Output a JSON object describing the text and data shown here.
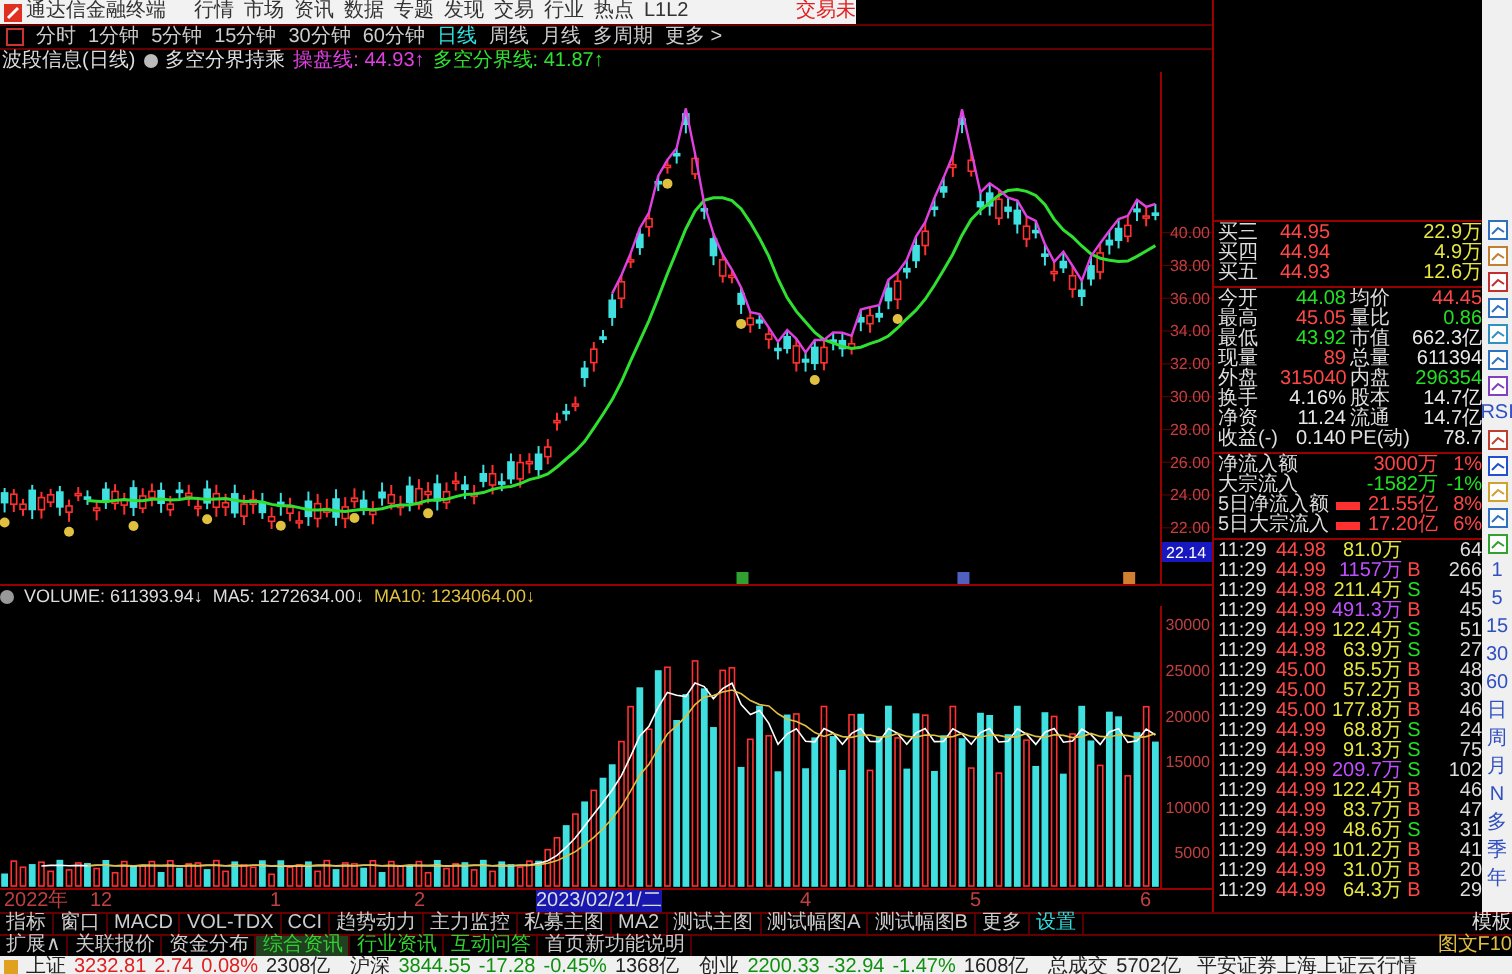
{
  "title_bar": {
    "app": "通达信金融终端",
    "menu": [
      "行情",
      "市场",
      "资讯",
      "数据",
      "专题",
      "发现",
      "交易",
      "行业",
      "热点",
      "L1L2"
    ],
    "login": "交易未"
  },
  "periods": [
    {
      "label": "分时",
      "selected": false
    },
    {
      "label": "1分钟",
      "selected": false
    },
    {
      "label": "5分钟",
      "selected": false
    },
    {
      "label": "15分钟",
      "selected": false
    },
    {
      "label": "30分钟",
      "selected": false
    },
    {
      "label": "60分钟",
      "selected": false
    },
    {
      "label": "日线",
      "selected": true
    },
    {
      "label": "周线",
      "selected": false
    },
    {
      "label": "月线",
      "selected": false
    },
    {
      "label": "多周期",
      "selected": false
    },
    {
      "label": "更多 >",
      "selected": false
    }
  ],
  "indicator": {
    "name": "波段信息(日线)",
    "formula": "多空分界持乘",
    "values": [
      {
        "label": "操盘线: 44.93↑",
        "kind": "trade"
      },
      {
        "label": "多空分界线: 41.87↑",
        "kind": "boundary"
      }
    ]
  },
  "price_axis": {
    "ticks": [
      "40.00",
      "38.00",
      "36.00",
      "34.00",
      "32.00",
      "30.00",
      "28.00",
      "26.00",
      "24.00",
      "22.00"
    ],
    "current": "22.14"
  },
  "volume": {
    "header": [
      {
        "text": "VOLUME: 611393.94↓",
        "kind": "vol"
      },
      {
        "text": "MA5: 1272634.00↓",
        "kind": "ma5"
      },
      {
        "text": "MA10: 1234064.00↓",
        "kind": "ma10"
      }
    ],
    "axis": [
      "30000",
      "25000",
      "20000",
      "15000",
      "10000",
      "5000"
    ]
  },
  "date_axis": [
    {
      "label": "2022年",
      "highlight": false
    },
    {
      "label": "12",
      "highlight": false
    },
    {
      "label": "1",
      "highlight": false
    },
    {
      "label": "2",
      "highlight": false
    },
    {
      "label": "2023/02/21/二",
      "highlight": true
    },
    {
      "label": "4",
      "highlight": false
    },
    {
      "label": "5",
      "highlight": false
    },
    {
      "label": "6",
      "highlight": false
    }
  ],
  "quote": {
    "book": [
      {
        "label": "买三",
        "price": "44.95",
        "volume": "22.9万"
      },
      {
        "label": "买四",
        "price": "44.94",
        "volume": "4.9万"
      },
      {
        "label": "买五",
        "price": "44.93",
        "volume": "12.6万"
      }
    ],
    "stats": [
      {
        "label": "今开",
        "value": "44.08",
        "color": "#22e022"
      },
      {
        "label": "均价",
        "value": "44.45",
        "color": "#ff4646"
      },
      {
        "label": "最高",
        "value": "45.05",
        "color": "#ff4646"
      },
      {
        "label": "量比",
        "value": "0.86",
        "color": "#22e022"
      },
      {
        "label": "最低",
        "value": "43.92",
        "color": "#22e022"
      },
      {
        "label": "市值",
        "value": "662.3亿",
        "color": "#e8e8e8"
      },
      {
        "label": "现量",
        "value": "89",
        "color": "#ff4646"
      },
      {
        "label": "总量",
        "value": "611394",
        "color": "#e8e8e8"
      },
      {
        "label": "外盘",
        "value": "315040",
        "color": "#ff4646"
      },
      {
        "label": "内盘",
        "value": "296354",
        "color": "#22e022"
      },
      {
        "label": "换手",
        "value": "4.16%",
        "color": "#e8e8e8"
      },
      {
        "label": "股本",
        "value": "14.7亿",
        "color": "#e8e8e8"
      },
      {
        "label": "净资",
        "value": "11.24",
        "color": "#e8e8e8"
      },
      {
        "label": "流通",
        "value": "14.7亿",
        "color": "#e8e8e8"
      },
      {
        "label": "收益(-)",
        "value": "0.140",
        "color": "#e8e8e8"
      },
      {
        "label": "PE(动)",
        "value": "78.7",
        "color": "#e8e8e8"
      }
    ],
    "flows": [
      {
        "label": "净流入额",
        "bar": false,
        "amount": "3000万",
        "pct": "1%",
        "color": "#ff4646"
      },
      {
        "label": "大宗流入",
        "bar": false,
        "amount": "-1582万",
        "pct": "-1%",
        "color": "#22e022"
      },
      {
        "label": "5日净流入额",
        "bar": true,
        "amount": "21.55亿",
        "pct": "8%",
        "color": "#ff4646"
      },
      {
        "label": "5日大宗流入",
        "bar": true,
        "amount": "17.20亿",
        "pct": "6%",
        "color": "#ff4646"
      }
    ]
  },
  "trades": [
    {
      "time": "11:29",
      "price": "44.98",
      "volume": "81.0万",
      "count": "64",
      "large": false
    },
    {
      "time": "11:29",
      "price": "44.99",
      "volume": "1157万",
      "side": "B",
      "count": "266",
      "large": true
    },
    {
      "time": "11:29",
      "price": "44.98",
      "volume": "211.4万",
      "side": "S",
      "count": "45",
      "large": false
    },
    {
      "time": "11:29",
      "price": "44.99",
      "volume": "491.3万",
      "side": "B",
      "count": "45",
      "large": true
    },
    {
      "time": "11:29",
      "price": "44.99",
      "volume": "122.4万",
      "side": "S",
      "count": "51",
      "large": false
    },
    {
      "time": "11:29",
      "price": "44.98",
      "volume": "63.9万",
      "side": "S",
      "count": "27",
      "large": false
    },
    {
      "time": "11:29",
      "price": "45.00",
      "volume": "85.5万",
      "side": "B",
      "count": "48",
      "large": false
    },
    {
      "time": "11:29",
      "price": "45.00",
      "volume": "57.2万",
      "side": "B",
      "count": "30",
      "large": false
    },
    {
      "time": "11:29",
      "price": "45.00",
      "volume": "177.8万",
      "side": "B",
      "count": "46",
      "large": false
    },
    {
      "time": "11:29",
      "price": "44.99",
      "volume": "68.8万",
      "side": "S",
      "count": "24",
      "large": false
    },
    {
      "time": "11:29",
      "price": "44.99",
      "volume": "91.3万",
      "side": "S",
      "count": "75",
      "large": false
    },
    {
      "time": "11:29",
      "price": "44.99",
      "volume": "209.7万",
      "side": "S",
      "count": "102",
      "large": true
    },
    {
      "time": "11:29",
      "price": "44.99",
      "volume": "122.4万",
      "side": "B",
      "count": "46",
      "large": false
    },
    {
      "time": "11:29",
      "price": "44.99",
      "volume": "83.7万",
      "side": "B",
      "count": "47",
      "large": false
    },
    {
      "time": "11:29",
      "price": "44.99",
      "volume": "48.6万",
      "side": "S",
      "count": "31",
      "large": false
    },
    {
      "time": "11:29",
      "price": "44.99",
      "volume": "101.2万",
      "side": "B",
      "count": "41",
      "large": false
    },
    {
      "time": "11:29",
      "price": "44.99",
      "volume": "31.0万",
      "side": "B",
      "count": "20",
      "large": false
    },
    {
      "time": "11:29",
      "price": "44.99",
      "volume": "64.3万",
      "side": "B",
      "count": "29",
      "large": false
    }
  ],
  "toolbar": {
    "indicator": "RSI",
    "periods": [
      "1",
      "5",
      "15",
      "30",
      "60",
      "日",
      "周",
      "月",
      "N",
      "多",
      "季",
      "年"
    ]
  },
  "tabs": [
    {
      "label": "指标",
      "kind": "tab",
      "selected": false
    },
    {
      "label": "窗口",
      "kind": "tab",
      "selected": false
    },
    {
      "label": "MACD",
      "kind": "tab",
      "selected": false
    },
    {
      "label": "VOL-TDX",
      "kind": "tab",
      "selected": false
    },
    {
      "label": "CCI",
      "kind": "tab",
      "selected": false
    },
    {
      "label": "趋势动力",
      "kind": "tab",
      "selected": false
    },
    {
      "label": "主力监控",
      "kind": "tab",
      "selected": false
    },
    {
      "label": "私募主图",
      "kind": "tab",
      "selected": false
    },
    {
      "label": "MA2",
      "kind": "tab",
      "selected": false
    },
    {
      "label": "测试主图",
      "kind": "tab",
      "selected": false
    },
    {
      "label": "测试幅图A",
      "kind": "tab",
      "selected": false
    },
    {
      "label": "测试幅图B",
      "kind": "tab",
      "selected": false
    },
    {
      "label": "更多",
      "kind": "tab",
      "selected": false
    },
    {
      "label": "设置",
      "kind": "setting",
      "selected": false
    }
  ],
  "template_button": "模板",
  "tabs2": [
    {
      "label": "扩展∧",
      "kind": "tab",
      "selected": false
    },
    {
      "label": "关联报价",
      "kind": "tab",
      "selected": false
    },
    {
      "label": "资金分布",
      "kind": "tab",
      "selected": false
    },
    {
      "label": "综合资讯",
      "kind": "news",
      "selected": true
    },
    {
      "label": "行业资讯",
      "kind": "news",
      "selected": false
    },
    {
      "label": "互动问答",
      "kind": "news",
      "selected": false
    },
    {
      "label": "首页新功能说明",
      "kind": "tab",
      "selected": false
    }
  ],
  "f10_button": "图文F10",
  "status_bar": [
    {
      "name": "上证",
      "value": "3232.81",
      "change": "2.74",
      "pct": "0.08%",
      "amount": "2308亿",
      "color": "#e02020"
    },
    {
      "name": "沪深",
      "value": "3844.55",
      "change": "-17.28",
      "pct": "-0.45%",
      "amount": "1368亿",
      "color": "#109010"
    },
    {
      "name": "创业",
      "value": "2200.33",
      "change": "-32.94",
      "pct": "-1.47%",
      "amount": "1608亿",
      "color": "#109010"
    }
  ],
  "total": {
    "name": "总成交",
    "amount": "5702亿"
  },
  "source": "平安证券上海上证云行情"
}
